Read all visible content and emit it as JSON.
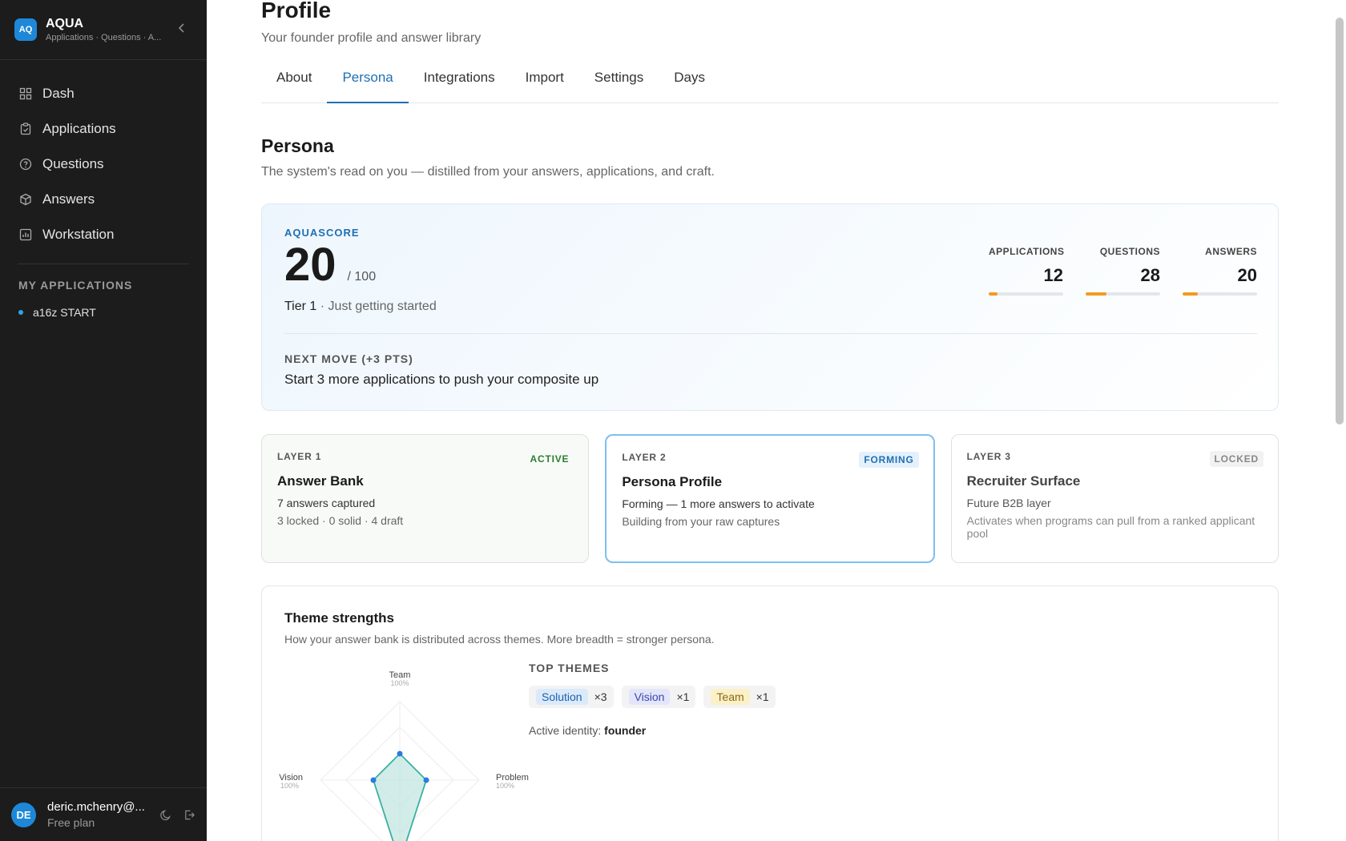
{
  "app": {
    "logo": "AQ",
    "name": "AQUA",
    "subtitle": "Applications · Questions · A..."
  },
  "nav": [
    {
      "label": "Dash",
      "icon": "grid-icon"
    },
    {
      "label": "Applications",
      "icon": "clipboard-icon"
    },
    {
      "label": "Questions",
      "icon": "help-circle-icon"
    },
    {
      "label": "Answers",
      "icon": "box-icon"
    },
    {
      "label": "Workstation",
      "icon": "chart-icon"
    }
  ],
  "my_applications": {
    "title": "MY APPLICATIONS",
    "items": [
      {
        "label": "a16z START"
      }
    ]
  },
  "user": {
    "initials": "DE",
    "name": "deric.mchenry@...",
    "plan": "Free plan"
  },
  "page": {
    "title": "Profile",
    "subtitle": "Your founder profile and answer library"
  },
  "tabs": [
    "About",
    "Persona",
    "Integrations",
    "Import",
    "Settings",
    "Days"
  ],
  "active_tab": "Persona",
  "persona": {
    "title": "Persona",
    "subtitle": "The system's read on you — distilled from your answers, applications, and craft."
  },
  "score": {
    "label": "AQUASCORE",
    "value": "20",
    "max": "/ 100",
    "tier": "Tier 1",
    "tier_desc": "· Just getting started",
    "stats": [
      {
        "label": "APPLICATIONS",
        "value": "12",
        "progress": 0.12
      },
      {
        "label": "QUESTIONS",
        "value": "28",
        "progress": 0.28
      },
      {
        "label": "ANSWERS",
        "value": "20",
        "progress": 0.2
      }
    ],
    "next_label": "NEXT MOVE (+3 PTS)",
    "next_text": "Start 3 more applications to push your composite up"
  },
  "layers": [
    {
      "num": "LAYER 1",
      "badge": "ACTIVE",
      "title": "Answer Bank",
      "line1": "7 answers captured",
      "line2": "3 locked · 0 solid · 4 draft"
    },
    {
      "num": "LAYER 2",
      "badge": "FORMING",
      "title": "Persona Profile",
      "line1": "Forming — 1 more answers to activate",
      "line2": "Building from your raw captures"
    },
    {
      "num": "LAYER 3",
      "badge": "LOCKED",
      "title": "Recruiter Surface",
      "line1": "Future B2B layer",
      "line2": "Activates when programs can pull from a ranked applicant pool"
    }
  ],
  "themes": {
    "title": "Theme strengths",
    "subtitle": "How your answer bank is distributed across themes. More breadth = stronger persona.",
    "radar_axes": [
      {
        "label": "Team",
        "pct": "100%"
      },
      {
        "label": "Problem",
        "pct": "100%"
      },
      {
        "label": "Vision",
        "pct": "100%"
      }
    ],
    "top_label": "TOP THEMES",
    "top": [
      {
        "name": "Solution",
        "count": "×3",
        "bg": "#dbeafb",
        "fg": "#1f5fa8"
      },
      {
        "name": "Vision",
        "count": "×1",
        "bg": "#e3e6fb",
        "fg": "#3b46a8"
      },
      {
        "name": "Team",
        "count": "×1",
        "bg": "#fbf0c8",
        "fg": "#8a6a10"
      }
    ],
    "identity_label": "Active identity:",
    "identity_value": "founder"
  },
  "colors": {
    "accent": "#1f6fb3",
    "sidebar": "#1c1c1c",
    "progress": "#f29b1f",
    "radar": "#3bb0a0"
  }
}
